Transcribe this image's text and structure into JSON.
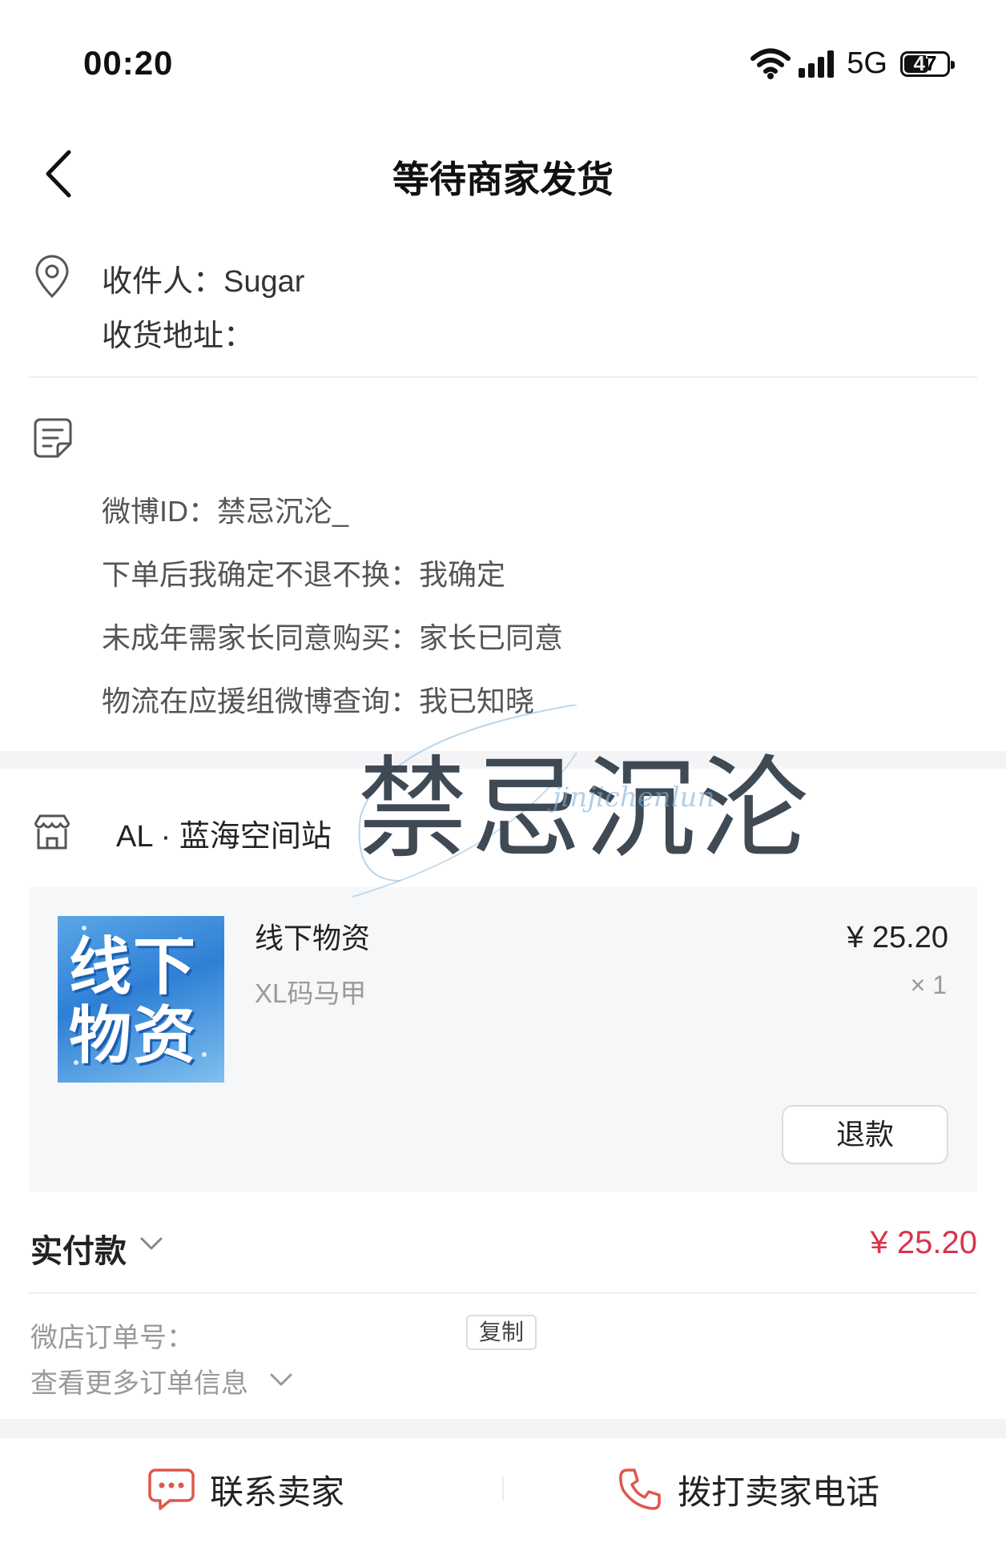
{
  "status_bar": {
    "time": "00:20",
    "network": "5G",
    "battery": "47"
  },
  "nav": {
    "title": "等待商家发货",
    "back_icon": "chevron-left-icon"
  },
  "address": {
    "recipient": "收件人：Sugar",
    "address_label": "收货地址："
  },
  "remarks": [
    "微博ID：禁忌沉沦_",
    "下单后我确定不退不换：我确定",
    "未成年需家长同意购买：家长已同意",
    "物流在应援组微博查询：我已知晓"
  ],
  "shop": {
    "name": "AL · 蓝海空间站"
  },
  "product": {
    "thumbnail_text": "线下物资",
    "name": "线下物资",
    "spec": "XL码马甲",
    "price": "¥ 25.20",
    "qty": "× 1",
    "refund_label": "退款"
  },
  "payment": {
    "label": "实付款",
    "amount": "¥ 25.20",
    "amount_color": "#d8344b"
  },
  "order": {
    "number_label": "微店订单号：",
    "copy_label": "复制",
    "more_label": "查看更多订单信息"
  },
  "bottom": {
    "contact_label": "联系卖家",
    "call_label": "拨打卖家电话",
    "icon_color": "#e0574b"
  },
  "watermark": {
    "text": "禁忌沉沦",
    "script": "jinjichenlun"
  }
}
